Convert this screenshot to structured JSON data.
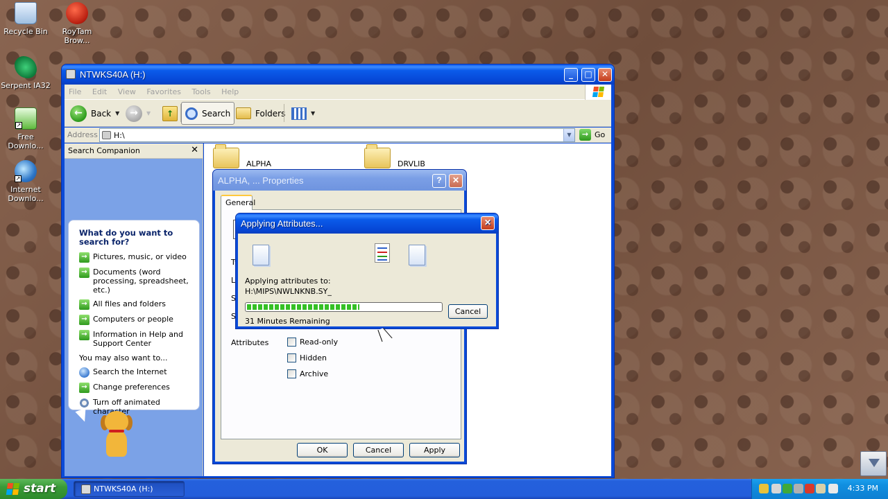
{
  "desktop": {
    "icons": [
      {
        "label": "Recycle Bin",
        "icon": "recycle-bin-icon"
      },
      {
        "label": "RoyTam Brow...",
        "icon": "browser-icon"
      },
      {
        "label": "Serpent IA32",
        "icon": "serpent-icon"
      },
      {
        "label": "Free Downlo...",
        "icon": "download-icon"
      },
      {
        "label": "Internet Downlo...",
        "icon": "internet-download-icon"
      }
    ]
  },
  "explorer": {
    "title": "NTWKS40A (H:)",
    "menu": [
      "File",
      "Edit",
      "View",
      "Favorites",
      "Tools",
      "Help"
    ],
    "toolbar": {
      "back": "Back",
      "search": "Search",
      "folders": "Folders"
    },
    "address": {
      "label": "Address",
      "value": "H:\\",
      "go": "Go"
    },
    "search_companion": {
      "title": "Search Companion",
      "question": "What do you want to search for?",
      "options": [
        "Pictures, music, or video",
        "Documents (word processing, spreadsheet, etc.)",
        "All files and folders",
        "Computers or people",
        "Information in Help and Support Center"
      ],
      "also_label": "You may also want to...",
      "also_options": [
        "Search the Internet",
        "Change preferences",
        "Turn off animated character"
      ]
    },
    "folders": [
      "ALPHA",
      "DRVLIB"
    ]
  },
  "properties": {
    "title": "ALPHA, ... Properties",
    "tab": "General",
    "partial_labels": [
      "Ty",
      "Lo",
      "Siz",
      "Siz"
    ],
    "attributes_label": "Attributes",
    "attributes": [
      {
        "label": "Read-only",
        "checked": false
      },
      {
        "label": "Hidden",
        "checked": false
      },
      {
        "label": "Archive",
        "checked": false
      }
    ],
    "buttons": {
      "ok": "OK",
      "cancel": "Cancel",
      "apply": "Apply"
    }
  },
  "applying": {
    "title": "Applying Attributes...",
    "label": "Applying attributes to:",
    "path": "H:\\MIPS\\NWLNKNB.SY_",
    "progress_fraction": 0.58,
    "remaining": "31 Minutes Remaining",
    "cancel": "Cancel"
  },
  "taskbar": {
    "start": "start",
    "task": "NTWKS40A (H:)",
    "clock": "4:33 PM"
  },
  "colors": {
    "xp_blue": "#0a4ad8",
    "start_green": "#3a9a38",
    "progress_green": "#35c025"
  }
}
